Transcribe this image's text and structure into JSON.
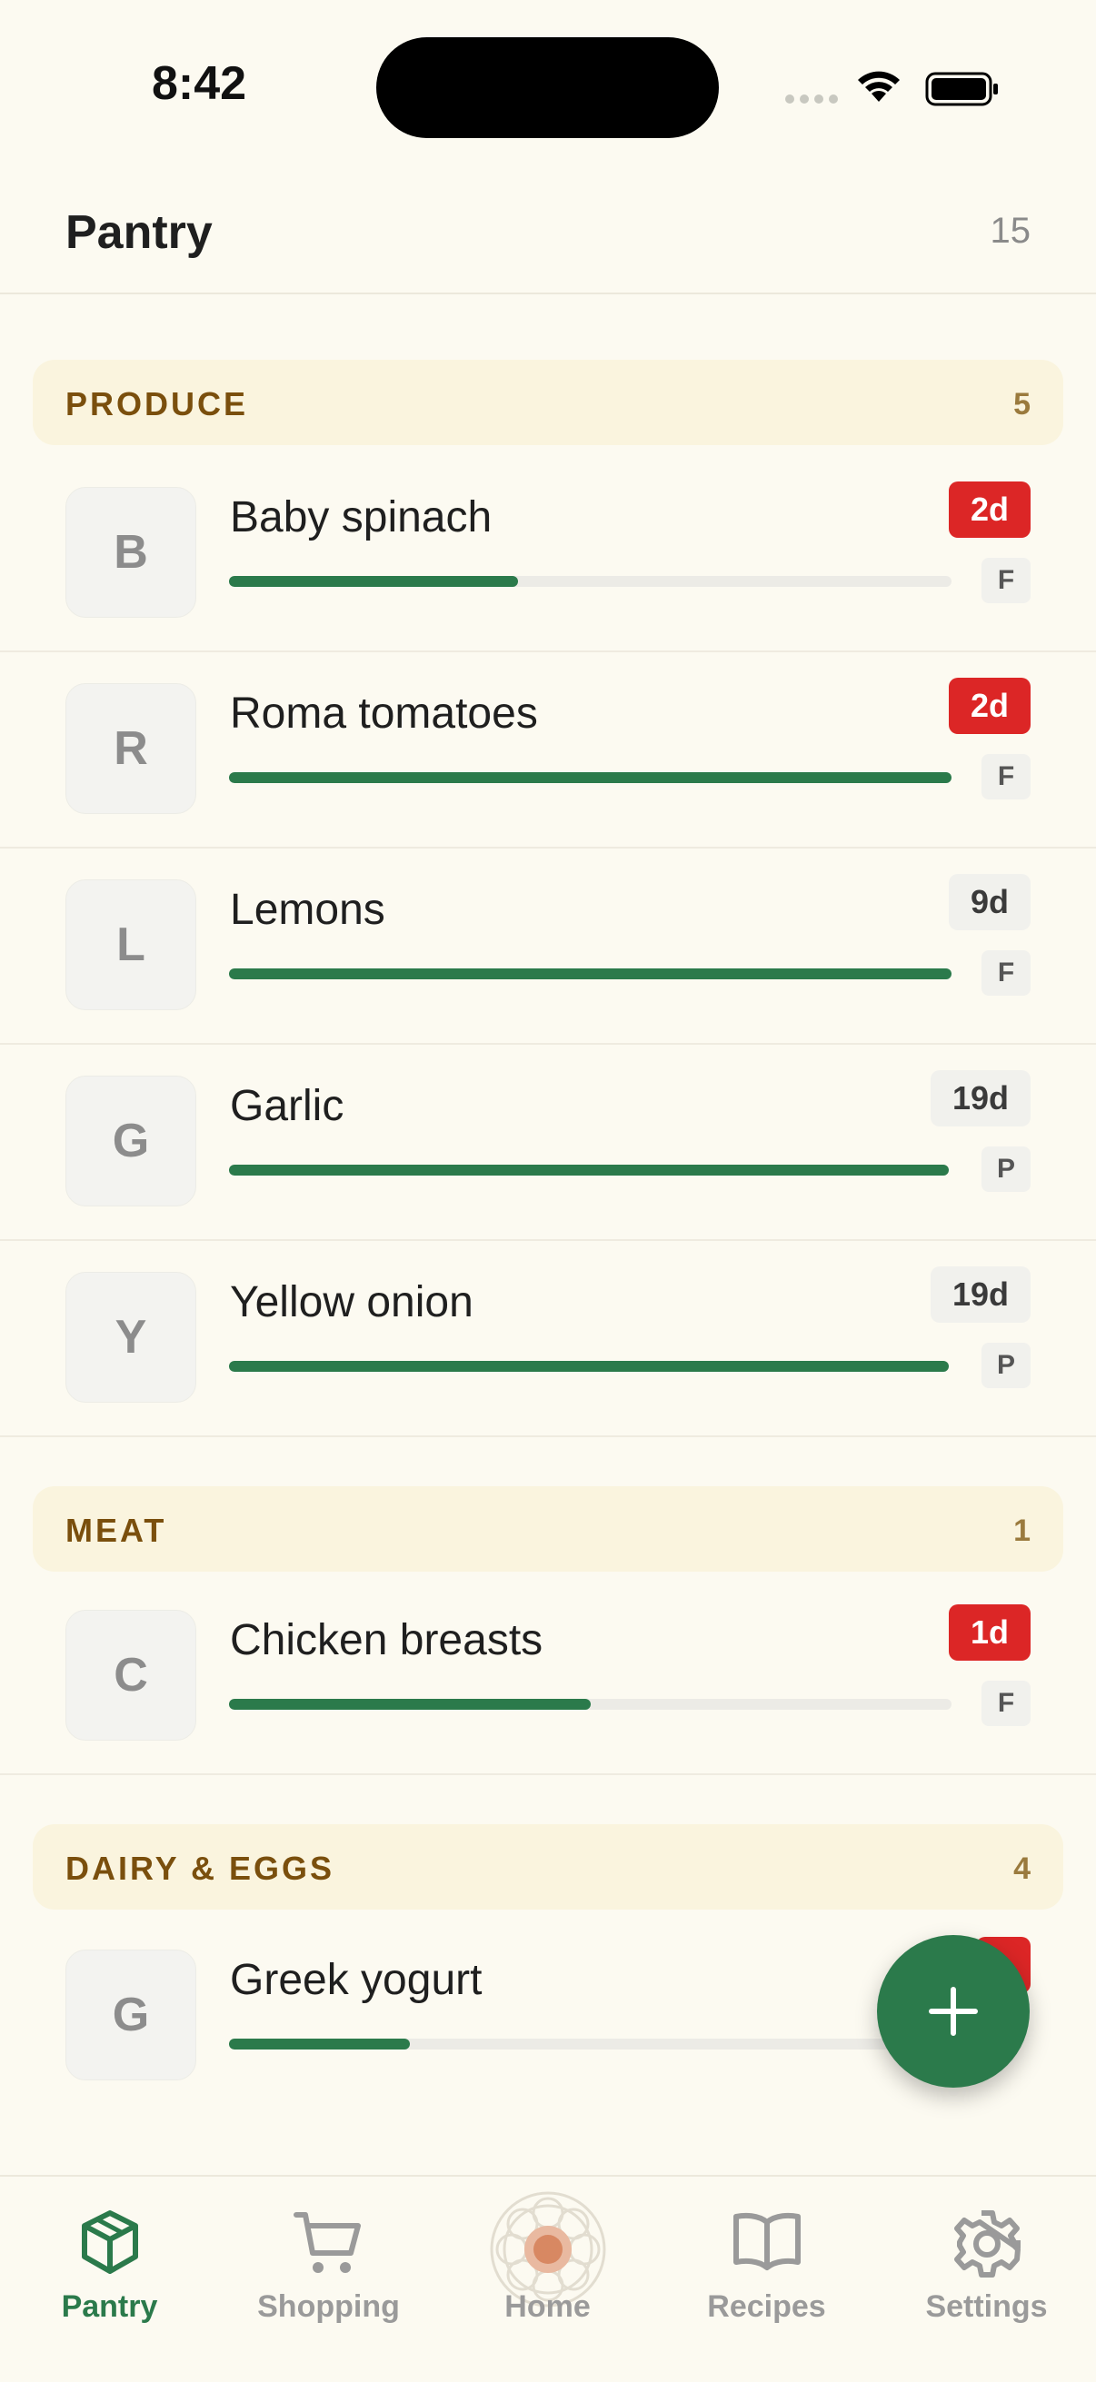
{
  "status_bar": {
    "time": "8:42"
  },
  "header": {
    "title": "Pantry",
    "count": "15"
  },
  "sections": [
    {
      "name": "PRODUCE",
      "count": "5"
    },
    {
      "name": "MEAT",
      "count": "1"
    },
    {
      "name": "DAIRY & EGGS",
      "count": "4"
    }
  ],
  "items": [
    {
      "initial": "B",
      "name": "Baby spinach",
      "days": "2d",
      "urgent": true,
      "location": "F",
      "level": 0.4
    },
    {
      "initial": "R",
      "name": "Roma tomatoes",
      "days": "2d",
      "urgent": true,
      "location": "F",
      "level": 1.0
    },
    {
      "initial": "L",
      "name": "Lemons",
      "days": "9d",
      "urgent": false,
      "location": "F",
      "level": 1.0
    },
    {
      "initial": "G",
      "name": "Garlic",
      "days": "19d",
      "urgent": false,
      "location": "P",
      "level": 1.0
    },
    {
      "initial": "Y",
      "name": "Yellow onion",
      "days": "19d",
      "urgent": false,
      "location": "P",
      "level": 1.0
    },
    {
      "initial": "C",
      "name": "Chicken breasts",
      "days": "1d",
      "urgent": true,
      "location": "F",
      "level": 0.5
    },
    {
      "initial": "G",
      "name": "Greek yogurt",
      "days": "",
      "urgent": true,
      "location": "",
      "level": 0.25
    }
  ],
  "tabs": [
    {
      "label": "Pantry",
      "icon": "box-icon",
      "active": true
    },
    {
      "label": "Shopping",
      "icon": "cart-icon",
      "active": false
    },
    {
      "label": "Home",
      "icon": "flower-icon",
      "active": false
    },
    {
      "label": "Recipes",
      "icon": "book-icon",
      "active": false
    },
    {
      "label": "Settings",
      "icon": "gear-icon",
      "active": false
    }
  ],
  "colors": {
    "accent": "#2b7a4b",
    "urgent": "#dc2626",
    "section_bg": "#faf4de",
    "section_text": "#7a4f0d",
    "background": "#fcfaf1"
  }
}
